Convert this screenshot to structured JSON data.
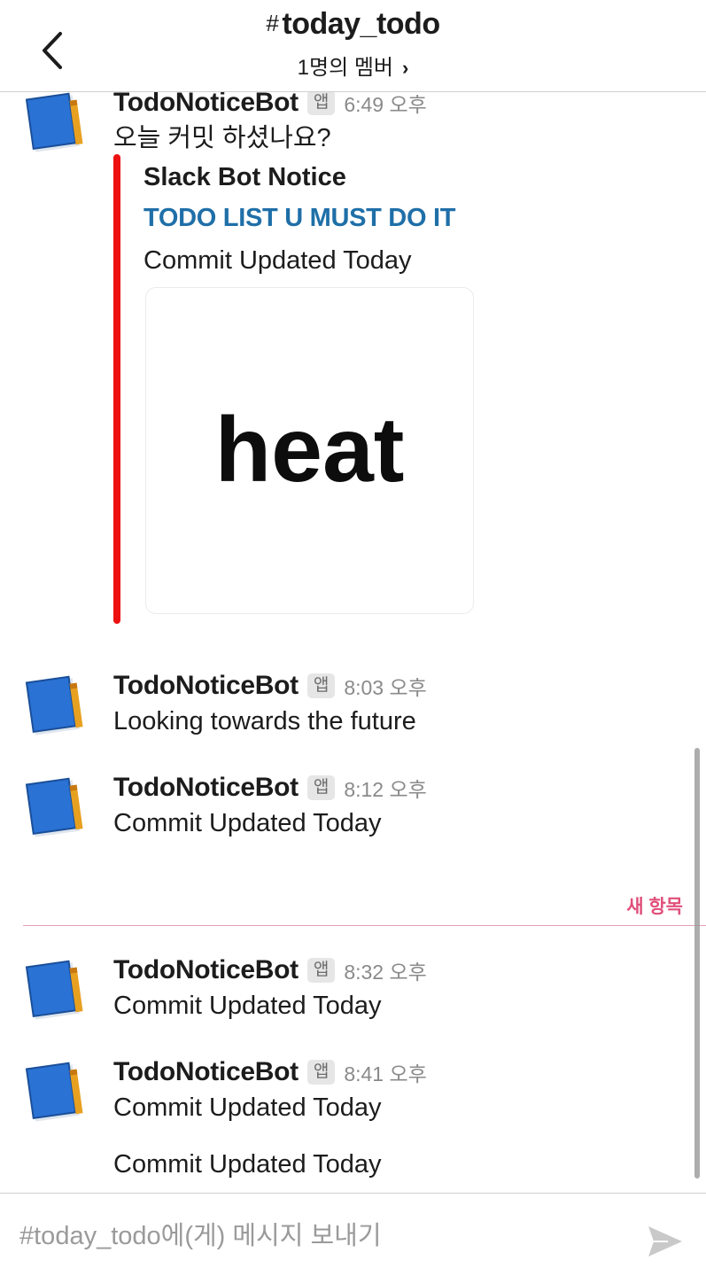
{
  "header": {
    "hash": "#",
    "channel_name": "today_todo",
    "members": "1명의 멤버"
  },
  "messages": [
    {
      "sender": "TodoNoticeBot",
      "badge": "앱",
      "time": "6:49 오후",
      "text": "오늘 커밋 하셨나요?",
      "attachment": {
        "author": "Slack Bot Notice",
        "title": "TODO LIST U MUST DO IT",
        "text": "Commit Updated Today",
        "image_text": "heat",
        "bar_color": "#ee1111"
      }
    },
    {
      "sender": "TodoNoticeBot",
      "badge": "앱",
      "time": "8:03 오후",
      "text": "Looking towards the future"
    },
    {
      "sender": "TodoNoticeBot",
      "badge": "앱",
      "time": "8:12 오후",
      "text": "Commit Updated Today"
    },
    {
      "sender": "TodoNoticeBot",
      "badge": "앱",
      "time": "8:32 오후",
      "text": "Commit Updated Today"
    },
    {
      "sender": "TodoNoticeBot",
      "badge": "앱",
      "time": "8:41 오후",
      "text": "Commit Updated Today",
      "followup": "Commit Updated Today"
    }
  ],
  "new_items_label": "새 항목",
  "composer": {
    "placeholder": "#today_todo에(게) 메시지 보내기"
  },
  "icons": {
    "back": "chevron-left-icon",
    "members_chevron": "chevron-right-icon",
    "avatar": "notebook-pencil-icon",
    "send": "send-arrow-icon"
  },
  "colors": {
    "link": "#1f6fa8",
    "new_divider": "#e0507a",
    "attachment_bar": "#ee1111"
  }
}
